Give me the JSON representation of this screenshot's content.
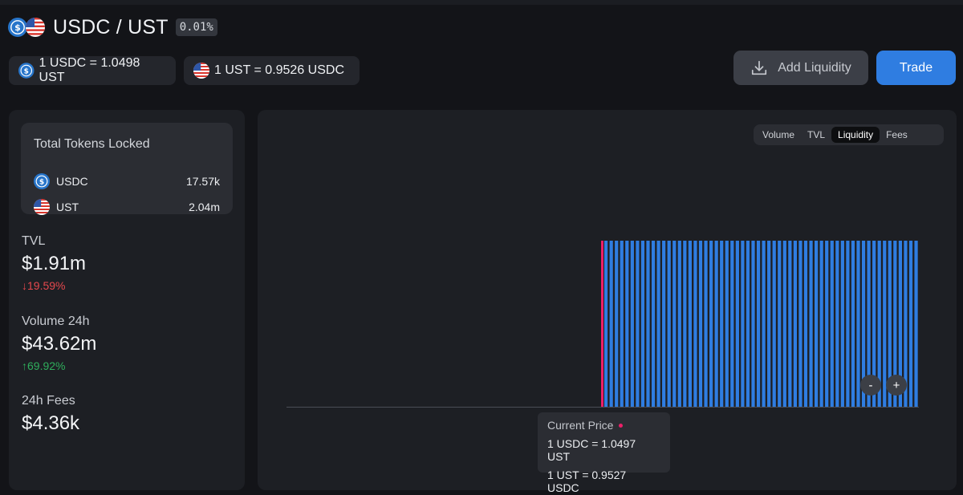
{
  "colors": {
    "usdc_blue": "#2775ca",
    "bar_blue": "#2f7de1",
    "current_price_marker": "#ec1f68",
    "negative": "#e5484d",
    "positive": "#2fae5c",
    "button_primary": "#2f7de1"
  },
  "header": {
    "icons": [
      "usdc-coin-icon",
      "ust-coin-icon"
    ],
    "title": "USDC / UST",
    "fee_tier": "0.01%",
    "rates": [
      {
        "icon": "usdc-coin-icon",
        "text": "1 USDC = 1.0498 UST"
      },
      {
        "icon": "ust-coin-icon",
        "text": "1 UST = 0.9526 USDC"
      }
    ],
    "add_liquidity_label": "Add Liquidity",
    "trade_label": "Trade"
  },
  "sidebar": {
    "total_tokens_locked": {
      "title": "Total Tokens Locked",
      "rows": [
        {
          "symbol": "USDC",
          "amount": "17.57k"
        },
        {
          "symbol": "UST",
          "amount": "2.04m"
        }
      ]
    },
    "stats": [
      {
        "label": "TVL",
        "value": "$1.91m",
        "change": "19.59%",
        "direction": "down"
      },
      {
        "label": "Volume 24h",
        "value": "$43.62m",
        "change": "69.92%",
        "direction": "up"
      },
      {
        "label": "24h Fees",
        "value": "$4.36k"
      }
    ]
  },
  "chart": {
    "tabs": [
      "Volume",
      "TVL",
      "Liquidity",
      "Fees"
    ],
    "active_tab": "Liquidity",
    "zoom_out_label": "-",
    "zoom_in_label": "+",
    "current_price": {
      "title": "Current Price",
      "line1": "1 USDC = 1.0497 UST",
      "line2": "1 UST = 0.9527 USDC"
    }
  },
  "chart_data": {
    "type": "bar",
    "description_series": "active liquidity per tick",
    "empty_ticks_before": 60,
    "current_price_tick_index": 60,
    "active_ticks": 60,
    "liquidity_values_relative": [
      1,
      1,
      1,
      1,
      1,
      1,
      1,
      1,
      1,
      1,
      1,
      1,
      1,
      1,
      1,
      1,
      1,
      1,
      1,
      1,
      1,
      1,
      1,
      1,
      1,
      1,
      1,
      1,
      1,
      1,
      1,
      1,
      1,
      1,
      1,
      1,
      1,
      1,
      1,
      1,
      1,
      1,
      1,
      1,
      1,
      1,
      1,
      1,
      1,
      1,
      1,
      1,
      1,
      1,
      1,
      1,
      1,
      1,
      1,
      1
    ],
    "ylim": [
      0,
      1.05
    ],
    "grid": false,
    "legend": "none"
  }
}
